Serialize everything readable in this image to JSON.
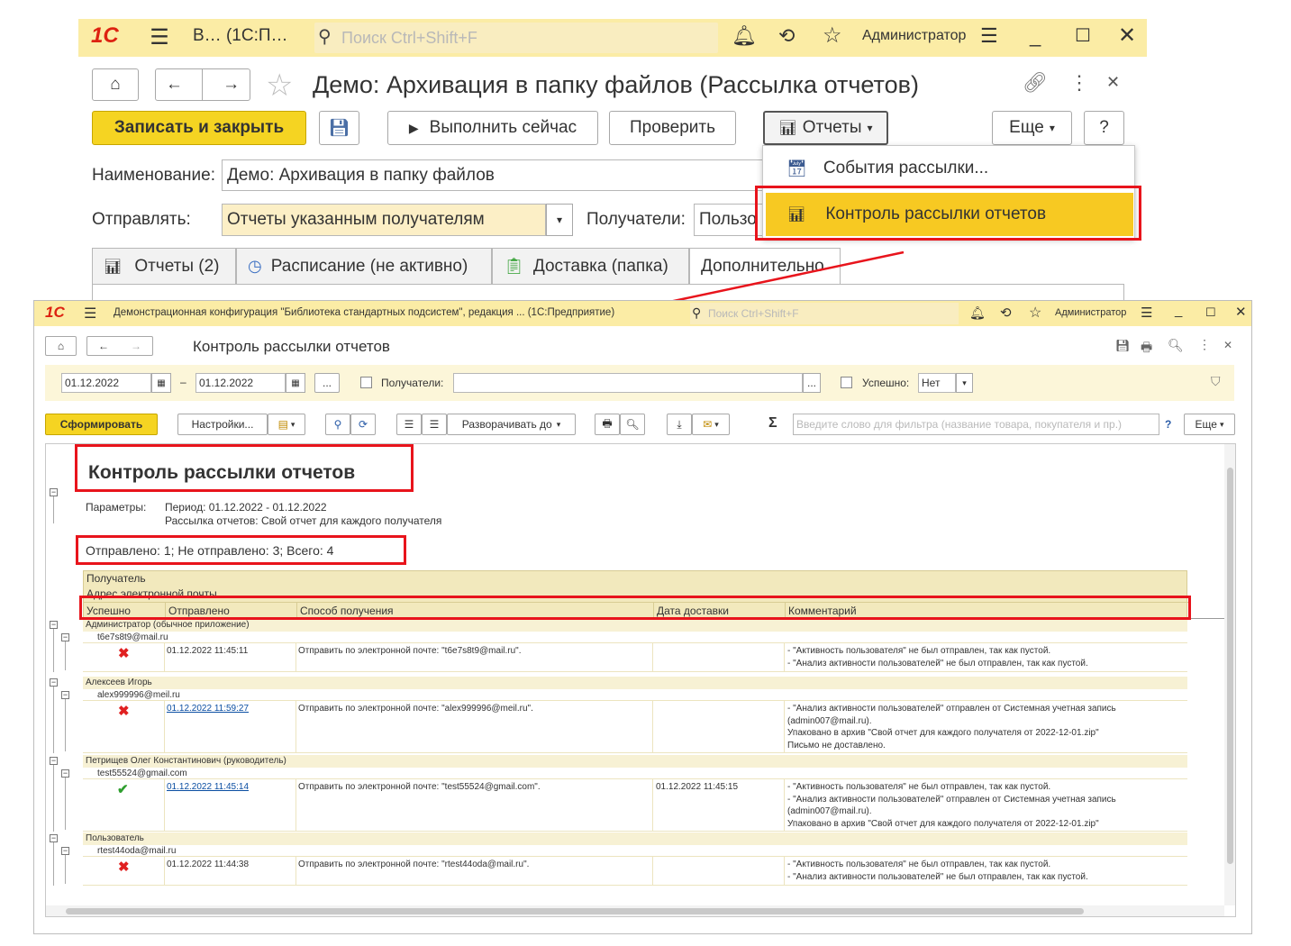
{
  "topbar": {
    "logo": "1С",
    "menu_icon": "hamburger-icon",
    "title": "В… (1С:П…",
    "search_placeholder": "Поиск Ctrl+Shift+F",
    "user": "Администратор"
  },
  "form": {
    "title": "Демо: Архивация в папку файлов (Рассылка отчетов)",
    "buttons": {
      "save_close": "Записать и закрыть",
      "run_now": "Выполнить сейчас",
      "check": "Проверить",
      "reports": "Отчеты",
      "more": "Еще",
      "help": "?"
    },
    "name_label": "Наименование:",
    "name_value": "Демо: Архивация в папку файлов",
    "send_label": "Отправлять:",
    "send_value": "Отчеты указанным получателям",
    "recipients_label": "Получатели:",
    "recipients_value": "Пользо",
    "tabs": [
      "Отчеты (2)",
      "Расписание (не активно)",
      "Доставка (папка)",
      "Дополнительно"
    ],
    "menu": {
      "item1": "События рассылки...",
      "item2": "Контроль рассылки отчетов"
    }
  },
  "report_window": {
    "titlebar": {
      "logo": "1С",
      "title": "Демонстрационная конфигурация \"Библиотека стандартных подсистем\", редакция ...  (1С:Предприятие)",
      "search_placeholder": "Поиск Ctrl+Shift+F",
      "user": "Администратор"
    },
    "title": "Контроль рассылки отчетов",
    "filter": {
      "date_from": "01.12.2022",
      "dash": "–",
      "date_to": "01.12.2022",
      "ellipsis": "...",
      "recipients_label": "Получатели:",
      "success_label": "Успешно:",
      "success_value": "Нет"
    },
    "toolbar": {
      "generate": "Сформировать",
      "settings": "Настройки...",
      "expand": "Разворачивать до",
      "sigma": "Σ",
      "filter_placeholder": "Введите слово для фильтра (название товара, покупателя и пр.)",
      "help": "?",
      "more": "Еще"
    },
    "report": {
      "heading": "Контроль рассылки отчетов",
      "params_label": "Параметры:",
      "period": "Период: 01.12.2022 - 01.12.2022",
      "mailing": "Рассылка отчетов: Свой отчет для каждого получателя",
      "summary": "Отправлено: 1; Не отправлено: 3; Всего: 4",
      "header": {
        "recipient": "Получатель",
        "email": "Адрес электронной почты",
        "columns": [
          "Успешно",
          "Отправлено",
          "Способ получения",
          "Дата доставки",
          "Комментарий"
        ]
      },
      "groups": [
        {
          "recipient": "Администратор (обычное приложение)",
          "email": "t6e7s8t9@mail.ru",
          "success": false,
          "sent": "01.12.2022 11:45:11",
          "sent_link": false,
          "method": "Отправить по электронной почте: \"t6e7s8t9@mail.ru\".",
          "delivered": "",
          "comment": [
            "- \"Активность пользователя\" не был отправлен, так как пустой.",
            "- \"Анализ активности пользователей\" не был отправлен, так как пустой."
          ]
        },
        {
          "recipient": "Алексеев Игорь",
          "email": "alex999996@meil.ru",
          "success": false,
          "sent": "01.12.2022 11:59:27",
          "sent_link": true,
          "method": "Отправить по электронной почте: \"alex999996@meil.ru\".",
          "delivered": "",
          "comment": [
            "- \"Анализ активности пользователей\" отправлен от Системная учетная запись",
            "(admin007@mail.ru).",
            "Упаковано в архив \"Свой отчет для каждого получателя от 2022-12-01.zip\"",
            "Письмо не доставлено."
          ]
        },
        {
          "recipient": "Петрищев Олег Константинович (руководитель)",
          "email": "test55524@gmail.com",
          "success": true,
          "sent": "01.12.2022 11:45:14",
          "sent_link": true,
          "method": "Отправить по электронной почте: \"test55524@gmail.com\".",
          "delivered": "01.12.2022 11:45:15",
          "comment": [
            "- \"Активность пользователя\" не был отправлен, так как пустой.",
            "- \"Анализ активности пользователей\" отправлен от Системная учетная запись",
            "(admin007@mail.ru).",
            "Упаковано в архив \"Свой отчет для каждого получателя от 2022-12-01.zip\""
          ]
        },
        {
          "recipient": "Пользователь",
          "email": "rtest44oda@mail.ru",
          "success": false,
          "sent": "01.12.2022 11:44:38",
          "sent_link": false,
          "method": "Отправить по электронной почте: \"rtest44oda@mail.ru\".",
          "delivered": "",
          "comment": [
            "- \"Активность пользователя\" не был отправлен, так как пустой.",
            "- \"Анализ активности пользователей\" не был отправлен, так как пустой."
          ]
        }
      ]
    }
  },
  "colors": {
    "highlight": "#e8141c",
    "accent_yellow": "#f5d422",
    "topbar": "#fbeca5",
    "success": "#2e9e2e",
    "fail": "#e02020"
  }
}
